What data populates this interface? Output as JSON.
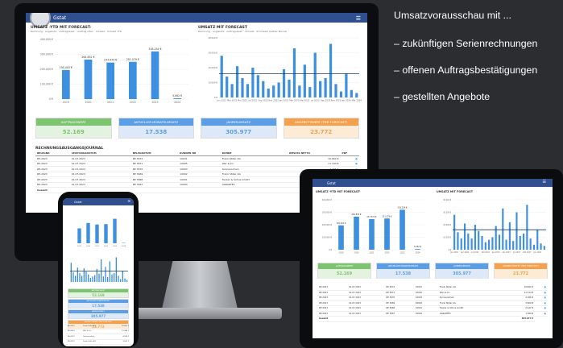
{
  "side_text": {
    "heading": "Umsatzvorausschau mit ...",
    "bullets": [
      "– zukünftigen Serienrechnungen",
      "– offenen Auftragsbestätigungen",
      "– gestellten Angebote"
    ]
  },
  "app": {
    "name": "Gstat",
    "menu_icon": "hamburger-icon",
    "logo_icon": "globe-logo-icon"
  },
  "colors": {
    "topbar": "#2f4f8f",
    "bar": "#3d8fe0",
    "line": "#1b3a6b",
    "kpi_green": "#7cc46f",
    "kpi_blue": "#5b9ee6",
    "kpi_orange": "#f4a04c"
  },
  "ytd_chart": {
    "title": "UMSATZ -YTD MIT FORECAST-",
    "legend": [
      "Rechnung",
      "Angebote",
      "Auftragsbest.",
      "Auftrag offen",
      "Umsatz",
      "Umsatz YTD"
    ],
    "chart_data": {
      "type": "bar",
      "categories": [
        "2019",
        "2020",
        "2021",
        "2022",
        "2023",
        "2024"
      ],
      "values": [
        195000,
        265000,
        245000,
        250000,
        320000,
        5000
      ],
      "ylim": [
        0,
        400000
      ],
      "yticks": [
        "400.000 €",
        "300.000 €",
        "200.000 €",
        "100.000 €",
        "0 €"
      ],
      "data_labels": [
        "195.403 €",
        "264.832 €",
        "247.574 €",
        "251.079 €",
        "318.254 €",
        "5.062 €"
      ]
    }
  },
  "monthly_chart": {
    "title": "UMSATZ MIT FORECAST",
    "legend": [
      "Rechnung",
      "Angebote",
      "Auftragsbest.",
      "Umsatz",
      "Ø Umsatz (letzter Monat)"
    ],
    "chart_data": {
      "type": "bar",
      "yticks": [
        "40.000 €",
        "30.000 €",
        "20.000 €",
        "10.000 €",
        "0 €"
      ],
      "ylim": [
        0,
        40000
      ],
      "categories": [
        "Jan 2022",
        "Feb 2022",
        "Mär 2022",
        "Apr 2022",
        "Mai 2022",
        "Jun 2022",
        "Jul 2022",
        "Aug 2022",
        "Sep 2022",
        "Okt 2022",
        "Nov 2022",
        "Dez 2022",
        "Jan 2023",
        "Feb 2023",
        "Mär 2023",
        "Apr 2023",
        "Mai 2023",
        "Jun 2023",
        "Jul 2023",
        "Aug 2023",
        "Sep 2023",
        "Okt 2023",
        "Nov 2023",
        "Dez 2023",
        "Jan 2024",
        "Feb 2024",
        "Mär 2024"
      ],
      "values": [
        28000,
        14000,
        9000,
        21000,
        13000,
        9000,
        20000,
        15000,
        11000,
        6000,
        8000,
        10000,
        19000,
        12000,
        33000,
        8000,
        22000,
        7000,
        30000,
        11000,
        13000,
        36000,
        9000,
        4000,
        16000,
        5000,
        3000
      ],
      "avg_line": 16000
    }
  },
  "kpis": [
    {
      "label": "AUFTRAGSWERT",
      "value": "52.169",
      "color": "#7cc46f",
      "bg": "#e4f3df"
    },
    {
      "label": "AKTUELLER MONATSUMSATZ",
      "value": "17.538",
      "color": "#5b9ee6",
      "bg": "#dde9f8"
    },
    {
      "label": "JAHRESUMSATZ",
      "value": "305.977",
      "color": "#5b9ee6",
      "bg": "#dde9f8"
    },
    {
      "label": "ANGEBOTSWERT (TBD FORECAST)",
      "value": "23.772",
      "color": "#f4a04c",
      "bg": "#fdebd6"
    }
  ],
  "journal": {
    "title": "RECHNUNGSAUSGANGSJOURNAL",
    "headers": [
      "BELEGNR",
      "LEISTUNGSDATUM",
      "BELEGDATUM",
      "KUNDEN NR",
      "KUNDE",
      "UMSATZ NETTO",
      "PDF"
    ],
    "rows": [
      [
        "RE-2023",
        "01.07.2023",
        "RE 3672",
        "10031",
        "Frank Stiller AG",
        "16.662 €"
      ],
      [
        "RE-2023",
        "01.07.2023",
        "RE 3671",
        "10005",
        "Wer & Co.",
        "11.344 €"
      ],
      [
        "RE-2023",
        "01.07.2023",
        "RE 3670",
        "10003",
        "Sonnenschein",
        "4.186 €"
      ],
      [
        "RE-2023",
        "01.07.2023",
        "RE 3669",
        "10002",
        "Frank Stiller AG",
        "3.600 €"
      ],
      [
        "RE-2023",
        "01.07.2023",
        "RE 3668",
        "10001",
        "Tauber & Söhne GmbH",
        "2.447 €"
      ],
      [
        "RE-2023",
        "01.07.2023",
        "RE 3667",
        "10004",
        "AGRARTEC",
        "1.380 €"
      ]
    ],
    "total_label": "Gesamt",
    "total_value": "305.977 €"
  }
}
